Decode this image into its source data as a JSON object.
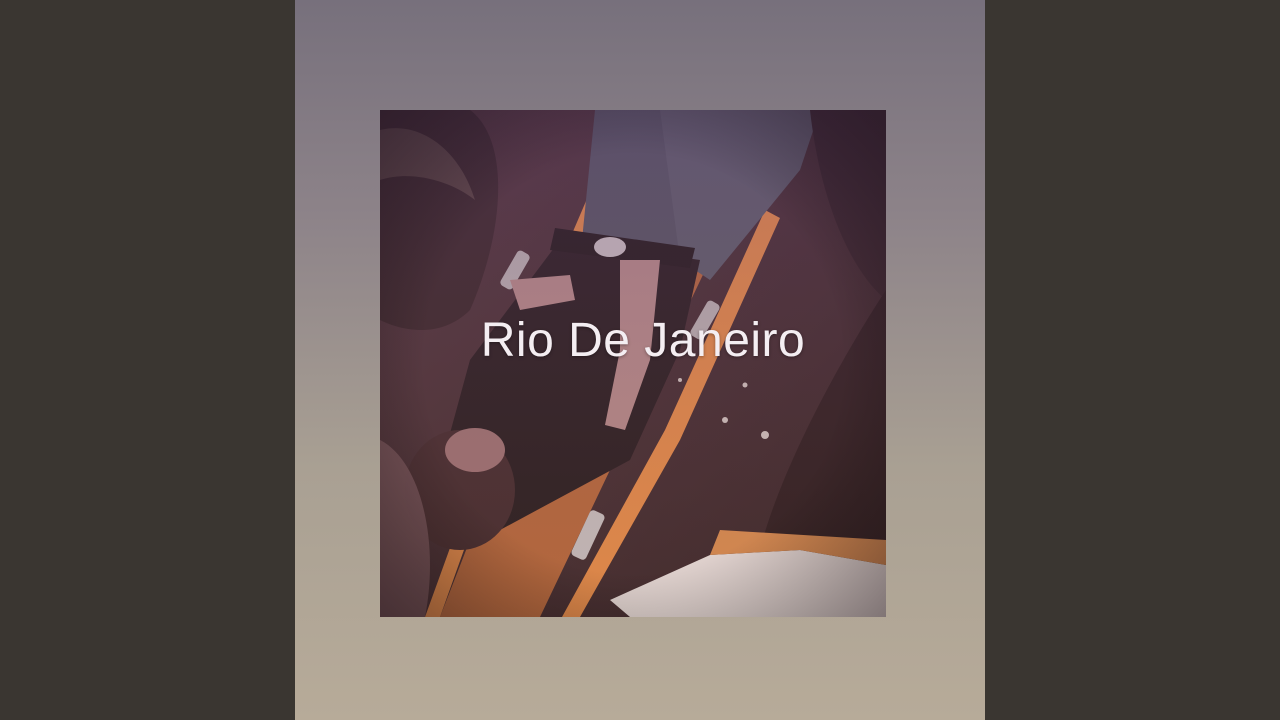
{
  "cover": {
    "title": "Rio De Janeiro"
  },
  "colors": {
    "side_background": "#3a3631",
    "panel_top": "#77707c",
    "panel_bottom": "#b7ab99",
    "stretcher_orange": "#d9783a",
    "title_text": "#f4eef2"
  }
}
